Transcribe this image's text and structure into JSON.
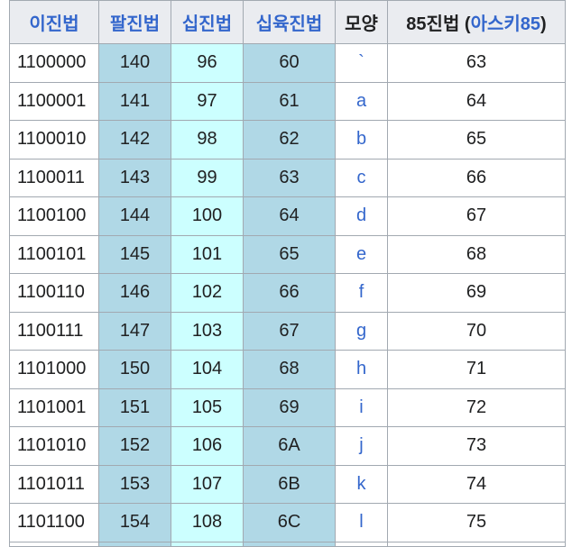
{
  "headers": {
    "binary": "이진법",
    "octal": "팔진법",
    "decimal": "십진법",
    "hex": "십육진법",
    "glyph": "모양",
    "base85_prefix": "85진법 (",
    "base85_link": "아스키85",
    "base85_suffix": ")"
  },
  "rows": [
    {
      "bin": "1100000",
      "oct": "140",
      "dec": "96",
      "hex": "60",
      "glyph": "`",
      "b85": "63"
    },
    {
      "bin": "1100001",
      "oct": "141",
      "dec": "97",
      "hex": "61",
      "glyph": "a",
      "b85": "64"
    },
    {
      "bin": "1100010",
      "oct": "142",
      "dec": "98",
      "hex": "62",
      "glyph": "b",
      "b85": "65"
    },
    {
      "bin": "1100011",
      "oct": "143",
      "dec": "99",
      "hex": "63",
      "glyph": "c",
      "b85": "66"
    },
    {
      "bin": "1100100",
      "oct": "144",
      "dec": "100",
      "hex": "64",
      "glyph": "d",
      "b85": "67"
    },
    {
      "bin": "1100101",
      "oct": "145",
      "dec": "101",
      "hex": "65",
      "glyph": "e",
      "b85": "68"
    },
    {
      "bin": "1100110",
      "oct": "146",
      "dec": "102",
      "hex": "66",
      "glyph": "f",
      "b85": "69"
    },
    {
      "bin": "1100111",
      "oct": "147",
      "dec": "103",
      "hex": "67",
      "glyph": "g",
      "b85": "70"
    },
    {
      "bin": "1101000",
      "oct": "150",
      "dec": "104",
      "hex": "68",
      "glyph": "h",
      "b85": "71"
    },
    {
      "bin": "1101001",
      "oct": "151",
      "dec": "105",
      "hex": "69",
      "glyph": "i",
      "b85": "72"
    },
    {
      "bin": "1101010",
      "oct": "152",
      "dec": "106",
      "hex": "6A",
      "glyph": "j",
      "b85": "73"
    },
    {
      "bin": "1101011",
      "oct": "153",
      "dec": "107",
      "hex": "6B",
      "glyph": "k",
      "b85": "74"
    },
    {
      "bin": "1101100",
      "oct": "154",
      "dec": "108",
      "hex": "6C",
      "glyph": "l",
      "b85": "75"
    }
  ],
  "colors": {
    "header_bg": "#eaecf0",
    "octal_bg": "#b0d8e6",
    "decimal_bg": "#ccffff",
    "hex_bg": "#b0d8e6",
    "link": "#3366cc",
    "border": "#a2a9b1"
  }
}
